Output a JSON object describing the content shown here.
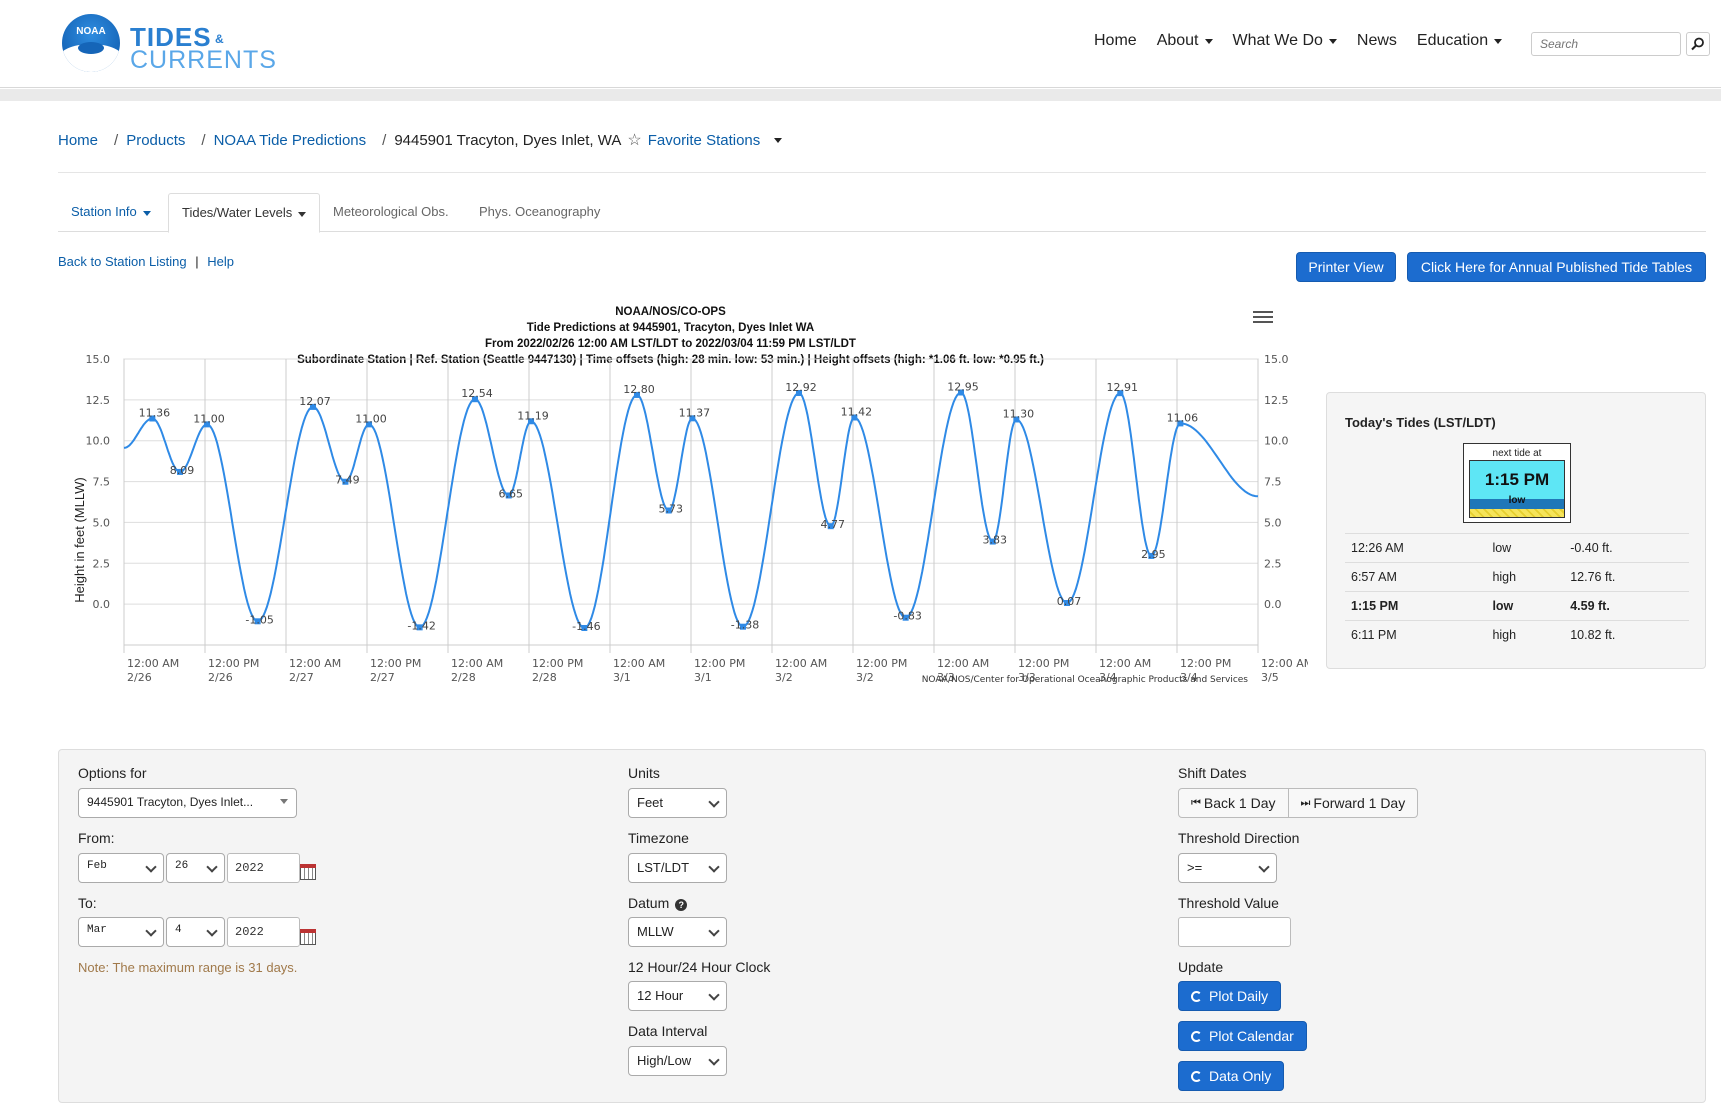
{
  "header": {
    "logo_line1": "TIDES",
    "logo_amp": "&",
    "logo_line2": "CURRENTS",
    "logo_badge": "NOAA",
    "nav": [
      "Home",
      "About",
      "What We Do",
      "News",
      "Education"
    ],
    "search_placeholder": "Search"
  },
  "breadcrumb": {
    "items": [
      "Home",
      "Products",
      "NOAA Tide Predictions"
    ],
    "current": "9445901 Tracyton, Dyes Inlet, WA",
    "favorites": "Favorite Stations"
  },
  "tabs": [
    "Station Info",
    "Tides/Water Levels",
    "Meteorological Obs.",
    "Phys. Oceanography"
  ],
  "sublinks": {
    "back": "Back to Station Listing",
    "sep": "|",
    "help": "Help"
  },
  "buttons": {
    "printer": "Printer View",
    "annual": "Click Here for Annual Published Tide Tables"
  },
  "chart": {
    "title": "NOAA/NOS/CO-OPS",
    "subtitle1": "Tide Predictions at 9445901, Tracyton, Dyes Inlet WA",
    "subtitle2": "From 2022/02/26 12:00 AM LST/LDT to 2022/03/04 11:59 PM LST/LDT",
    "subtitle3": "Subordinate Station | Ref. Station (Seattle 9447130) | Time offsets (high: 28 min. low: 53 min.) | Height offsets (high: *1.06 ft. low: *0.95 ft.)",
    "credit": "NOAA/NOS/Center for Operational Oceanographic Products and Services"
  },
  "chart_data": {
    "type": "line",
    "ylabel": "Height in feet (MLLW)",
    "ylim": [
      -2.5,
      15
    ],
    "yticks": [
      "15.0",
      "12.5",
      "10.0",
      "7.5",
      "5.0",
      "2.5",
      "0.0"
    ],
    "xticks": [
      [
        "12:00 AM",
        "2/26"
      ],
      [
        "12:00 PM",
        "2/26"
      ],
      [
        "12:00 AM",
        "2/27"
      ],
      [
        "12:00 PM",
        "2/27"
      ],
      [
        "12:00 AM",
        "2/28"
      ],
      [
        "12:00 PM",
        "2/28"
      ],
      [
        "12:00 AM",
        "3/1"
      ],
      [
        "12:00 PM",
        "3/1"
      ],
      [
        "12:00 AM",
        "3/2"
      ],
      [
        "12:00 PM",
        "3/2"
      ],
      [
        "12:00 AM",
        "3/3"
      ],
      [
        "12:00 PM",
        "3/3"
      ],
      [
        "12:00 AM",
        "3/4"
      ],
      [
        "12:00 PM",
        "3/4"
      ],
      [
        "12:00 AM",
        "3/5"
      ]
    ],
    "series": [
      {
        "hours": [
          4.2,
          8.3,
          12.3,
          19.8,
          28.0,
          32.8,
          36.3,
          43.8,
          52.0,
          57.0,
          60.3,
          68.2,
          76.0,
          80.7,
          84.2,
          91.7,
          100.0,
          104.7,
          108.2,
          115.8,
          124.0,
          128.7,
          132.2,
          139.7,
          147.6,
          152.2,
          156.5
        ],
        "values": [
          11.36,
          8.09,
          11.0,
          -1.05,
          12.07,
          7.49,
          11.0,
          -1.42,
          12.54,
          6.65,
          11.19,
          -1.46,
          12.8,
          5.73,
          11.37,
          -1.38,
          12.92,
          4.77,
          11.42,
          -0.83,
          12.95,
          3.83,
          11.3,
          0.07,
          12.91,
          2.95,
          11.06
        ],
        "labels": [
          "11.36",
          "8.09",
          "11.00",
          "-1.05",
          "12.07",
          "7.49",
          "11.00",
          "-1.42",
          "12.54",
          "6.65",
          "11.19",
          "-1.46",
          "12.80",
          "5.73",
          "11.37",
          "-1.38",
          "12.92",
          "4.77",
          "11.42",
          "-0.83",
          "12.95",
          "3.83",
          "11.30",
          "0.07",
          "12.91",
          "2.95",
          "11.06"
        ]
      }
    ],
    "color": "#2f8ae6",
    "grid": true
  },
  "today": {
    "title": "Today's Tides (LST/LDT)",
    "next_label": "next tide at",
    "next_time": "1:15 PM",
    "next_state": "low",
    "rows": [
      {
        "time": "12:26 AM",
        "type": "low",
        "height": "-0.40 ft."
      },
      {
        "time": "6:57 AM",
        "type": "high",
        "height": "12.76 ft."
      },
      {
        "time": "1:15 PM",
        "type": "low",
        "height": "4.59 ft."
      },
      {
        "time": "6:11 PM",
        "type": "high",
        "height": "10.82 ft."
      }
    ]
  },
  "options": {
    "options_for": "Options for",
    "station": "9445901 Tracyton, Dyes Inlet...",
    "from": "From:",
    "from_month": "Feb",
    "from_day": "26",
    "from_year": "2022",
    "to": "To:",
    "to_month": "Mar",
    "to_day": "4",
    "to_year": "2022",
    "note": "Note: The maximum range is 31 days.",
    "units_label": "Units",
    "units": "Feet",
    "tz_label": "Timezone",
    "tz": "LST/LDT",
    "datum_label": "Datum",
    "datum": "MLLW",
    "clock_label": "12 Hour/24 Hour Clock",
    "clock": "12 Hour",
    "interval_label": "Data Interval",
    "interval": "High/Low",
    "shift_label": "Shift Dates",
    "back": "Back 1 Day",
    "forward": "Forward 1 Day",
    "threshold_dir_label": "Threshold Direction",
    "threshold_dir": ">=",
    "threshold_val_label": "Threshold Value",
    "threshold_val": "",
    "update_label": "Update",
    "plot_daily": "Plot Daily",
    "plot_calendar": "Plot Calendar",
    "data_only": "Data Only"
  }
}
